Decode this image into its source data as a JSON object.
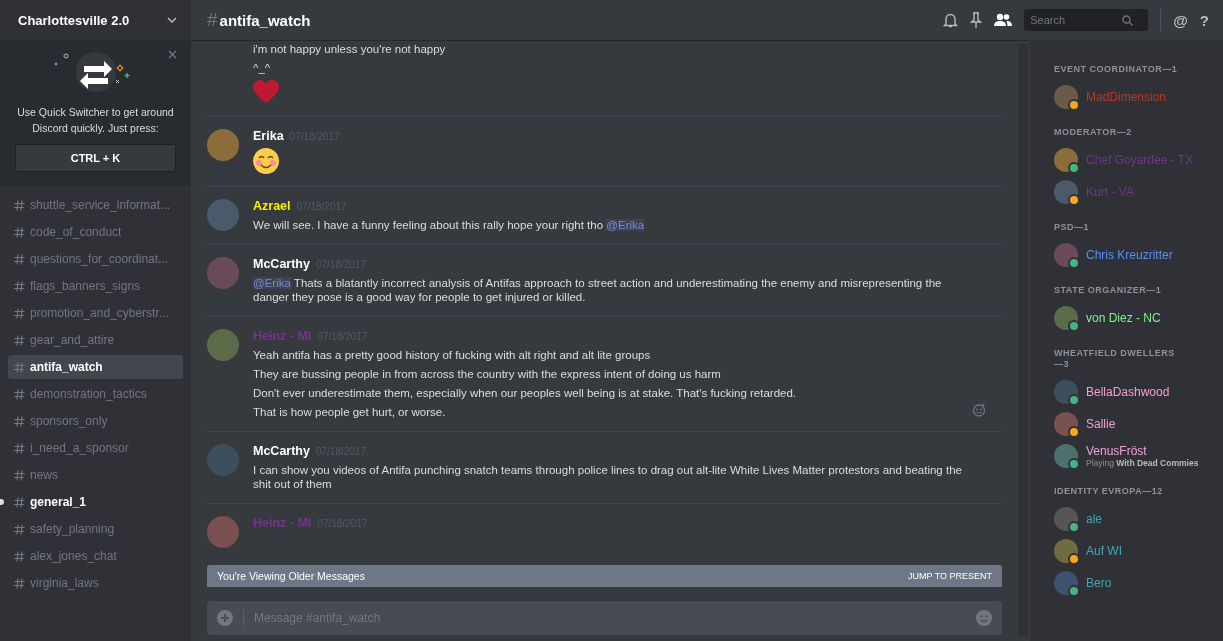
{
  "server": {
    "name": "Charlottesville 2.0"
  },
  "quick_switcher": {
    "text": "Use Quick Switcher to get around Discord quickly. Just press:",
    "shortcut": "CTRL + K"
  },
  "channels": [
    {
      "name": "shuttle_service_informat...",
      "selected": false,
      "unread": false
    },
    {
      "name": "code_of_conduct",
      "selected": false,
      "unread": false
    },
    {
      "name": "questions_for_coordinat...",
      "selected": false,
      "unread": false
    },
    {
      "name": "flags_banners_signs",
      "selected": false,
      "unread": false
    },
    {
      "name": "promotion_and_cyberstr...",
      "selected": false,
      "unread": false
    },
    {
      "name": "gear_and_attire",
      "selected": false,
      "unread": false
    },
    {
      "name": "antifa_watch",
      "selected": true,
      "unread": false
    },
    {
      "name": "demonstration_tactics",
      "selected": false,
      "unread": false
    },
    {
      "name": "sponsors_only",
      "selected": false,
      "unread": false
    },
    {
      "name": "i_need_a_sponsor",
      "selected": false,
      "unread": false
    },
    {
      "name": "news",
      "selected": false,
      "unread": false
    },
    {
      "name": "general_1",
      "selected": false,
      "unread": true
    },
    {
      "name": "safety_planning",
      "selected": false,
      "unread": false
    },
    {
      "name": "alex_jones_chat",
      "selected": false,
      "unread": false
    },
    {
      "name": "virginia_laws",
      "selected": false,
      "unread": false
    }
  ],
  "header": {
    "hash": "#",
    "channel": "antifa_watch",
    "search_placeholder": "Search",
    "at": "@",
    "help": "?"
  },
  "messages": [
    {
      "kind": "continued",
      "lines": [
        [
          {
            "kind": "text",
            "text": "i'm not happy unless you're not happy"
          }
        ],
        [
          {
            "kind": "text",
            "text": "^_^"
          }
        ],
        [
          {
            "kind": "heart"
          }
        ]
      ]
    },
    {
      "kind": "full",
      "author": "Erika",
      "color": "#ffffff",
      "time": "07/18/2017",
      "lines": [
        [
          {
            "kind": "smile"
          }
        ]
      ]
    },
    {
      "kind": "full",
      "author": "Azrael",
      "color": "#f1f10a",
      "time": "07/18/2017",
      "lines": [
        [
          {
            "kind": "text",
            "text": "We will see. I have a funny feeling about this rally hope your right tho "
          },
          {
            "kind": "mention",
            "text": "@Erika"
          }
        ]
      ]
    },
    {
      "kind": "full",
      "author": "McCarthy",
      "color": "#ffffff",
      "time": "07/18/2017",
      "lines": [
        [
          {
            "kind": "mention",
            "text": "@Erika"
          },
          {
            "kind": "text",
            "text": " Thats a blatantly incorrect analysis of Antifas approach to street action and underestimating the enemy and misrepresenting the danger they pose is a good way for people to get injured or killed."
          }
        ]
      ]
    },
    {
      "kind": "full",
      "author": "Heinz - MI",
      "color": "#71368a",
      "time": "07/18/2017",
      "reaction": true,
      "lines": [
        [
          {
            "kind": "text",
            "text": "Yeah antifa has a pretty good history of fucking with alt right and alt lite groups"
          }
        ],
        [
          {
            "kind": "text",
            "text": "They are bussing people in from across the country with the express intent of doing us harm"
          }
        ],
        [
          {
            "kind": "text",
            "text": "Don't ever underestimate them, especially when our peoples well being is at stake. That's fucking retarded."
          }
        ],
        [
          {
            "kind": "text",
            "text": "That is how people get hurt, or worse."
          }
        ]
      ]
    },
    {
      "kind": "full",
      "author": "McCarthy",
      "color": "#ffffff",
      "time": "07/18/2017",
      "lines": [
        [
          {
            "kind": "text",
            "text": "I can show you videos of Antifa punching snatch teams through police lines to drag out alt-lite White Lives Matter protestors and beating the shit out of them"
          }
        ]
      ]
    },
    {
      "kind": "full",
      "author": "Heinz - MI",
      "color": "#71368a",
      "time": "07/18/2017"
    }
  ],
  "older_bar": {
    "text": "You're Viewing Older Messages",
    "action": "JUMP TO PRESENT"
  },
  "composer": {
    "placeholder": "Message #antifa_watch"
  },
  "member_groups": [
    {
      "label": "EVENT COORDINATOR—1",
      "members": [
        {
          "name": "MadDimension",
          "color": "#b03a2e",
          "status_dot": {
            "color": "#faa61a"
          }
        }
      ]
    },
    {
      "label": "MODERATOR—2",
      "members": [
        {
          "name": "Chef Goyardee - TX",
          "color": "#71368a",
          "status_dot": {
            "color": "#43b581"
          }
        },
        {
          "name": "Kurt - VA",
          "color": "#71368a",
          "status_dot": {
            "color": "#faa61a"
          }
        }
      ]
    },
    {
      "label": "PSD—1",
      "members": [
        {
          "name": "Chris Kreuzritter",
          "color": "#5e8cf0",
          "status_dot": {
            "color": "#43b581"
          }
        }
      ]
    },
    {
      "label": "STATE ORGANIZER—1",
      "members": [
        {
          "name": "von Diez - NC",
          "color": "#7ff28f",
          "status_dot": {
            "color": "#43b581"
          }
        }
      ]
    },
    {
      "label": "WHEATFIELD DWELLERS—3",
      "members": [
        {
          "name": "BellaDashwood",
          "color": "#f2a0d4",
          "status_dot": {
            "color": "#43b581"
          }
        },
        {
          "name": "Sallie",
          "color": "#f2a0d4",
          "status_dot": {
            "color": "#faa61a"
          }
        },
        {
          "name": "VenusFröst",
          "color": "#f2a0d4",
          "status_dot": {
            "color": "#43b581"
          },
          "activity": "Playing **With Dead Commies**"
        }
      ]
    },
    {
      "label": "IDENTITY EVROPA—12",
      "members": [
        {
          "name": "ale",
          "color": "#3ea7b5",
          "status_dot": {
            "color": "#43b581"
          }
        },
        {
          "name": "Auf WI",
          "color": "#3ea7b5",
          "status_dot": {
            "color": "#faa61a"
          }
        },
        {
          "name": "Bero",
          "color": "#3ea7b5",
          "status_dot": {
            "color": "#43b581"
          }
        }
      ]
    }
  ]
}
